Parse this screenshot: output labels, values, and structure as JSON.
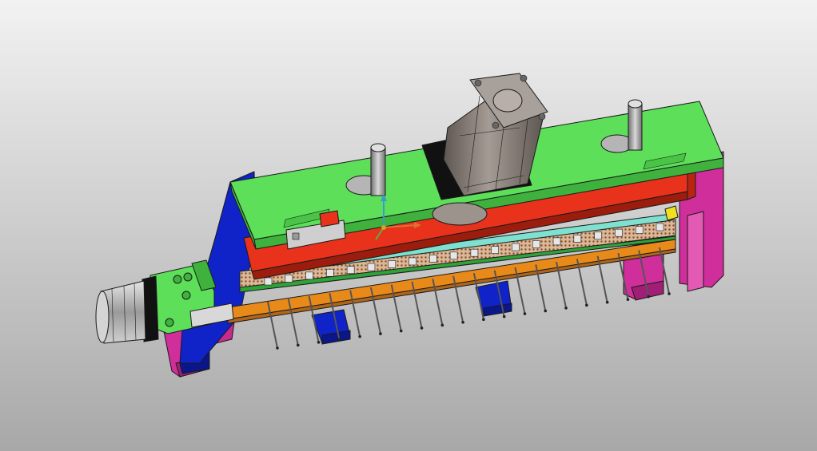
{
  "viewport": {
    "background_top": "#f2f2f2",
    "background_bottom": "#a8a8a8"
  },
  "model": {
    "components": [
      "top-plate",
      "red-press-plate",
      "blue-side-frame",
      "servo-motor",
      "pneumatic-cylinder",
      "guide-posts",
      "pin-array",
      "orange-bar",
      "magenta-supports",
      "blue-feet",
      "triad-axes"
    ],
    "colors": {
      "top_plate": "#5ddf5a",
      "top_plate_shade": "#3fb23d",
      "red_plate": "#e8321c",
      "blue_frame": "#0f23c8",
      "blue_frame_shade": "#0a168a",
      "magenta": "#d02e9a",
      "orange": "#e88a1a",
      "cyan_strip": "#7fe0d0",
      "motor_grey": "#8c8580",
      "motor_dark": "#4a4440",
      "motor_flange": "#111111",
      "post_grey": "#9a9a9a",
      "pin_metal": "#c8c8c8",
      "copper": "#b0703a"
    },
    "pin_count": 20
  }
}
